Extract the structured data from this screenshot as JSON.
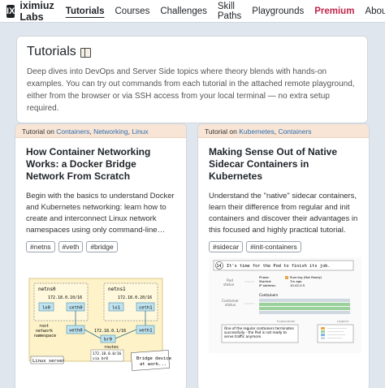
{
  "nav": {
    "logo": "IX",
    "brand": "iximiuz Labs",
    "links": [
      "Tutorials",
      "Courses",
      "Challenges",
      "Skill Paths",
      "Playgrounds",
      "Premium",
      "About"
    ]
  },
  "intro": {
    "title": "Tutorials",
    "description": "Deep dives into DevOps and Server Side topics where theory blends with hands-on examples. You can try out commands from each tutorial in the attached remote playground, either from the browser or via SSH access from your local terminal — no extra setup required."
  },
  "cards": [
    {
      "prefix": "Tutorial on",
      "topics": [
        "Containers",
        "Networking",
        "Linux"
      ],
      "title": "How Container Networking Works: a Docker Bridge Network From Scratch",
      "description": "Begin with the basics to understand Docker and Kubernetes networking: learn how to create and interconnect Linux network namespaces using only command-line…",
      "tags": [
        "#netns",
        "#veth",
        "#bridge"
      ],
      "diagram": {
        "netns0": "netns0",
        "netns1": "netns1",
        "ip0": "172.18.0.10/16",
        "ip1": "172.18.0.20/16",
        "lo0": "lo0",
        "lo1": "lo1",
        "ceth0": "ceth0",
        "ceth1": "ceth1",
        "veth0": "veth0",
        "veth1": "veth1",
        "root_ns": "root network namespace",
        "br_ip": "172.18.0.1/16",
        "br0": "br0",
        "routes": "routes",
        "route1": "172.18.0.0/16",
        "route2": "via br0",
        "linux_server": "Linux server",
        "bridge_note": "Bridge device at work..."
      }
    },
    {
      "prefix": "Tutorial on",
      "topics": [
        "Kubernetes",
        "Containers"
      ],
      "title": "Making Sense Out of Native Sidecar Containers in Kubernetes",
      "description": "Understand the \"native\" sidecar containers, learn their difference from regular and init containers and discover their advantages in this focused and highly practical tutorial.",
      "tags": [
        "#sidecar",
        "#init-containers"
      ],
      "diagram": {
        "step": "14",
        "step_text": "It's time for the Pod to finish its job.",
        "pod_status": "Pod status",
        "phase": "Phase:",
        "started": "Started:",
        "ip": "IP address:",
        "phase_val": "Running (Not Ready)",
        "started_val": "7m ago",
        "ip_val": "10.42.0.5",
        "containers": "Containers",
        "container_status": "Container status",
        "explanation_label": "Explanation",
        "legend_label": "Legend",
        "explanation": "One of the regular containers terminates successfully - the Pod is not ready to serve traffic anymore."
      }
    }
  ],
  "colors": {
    "accent": "#2f6fb0",
    "premium": "#c0264a",
    "card_header": "#f8e5d6",
    "background": "#dfe6ee"
  }
}
